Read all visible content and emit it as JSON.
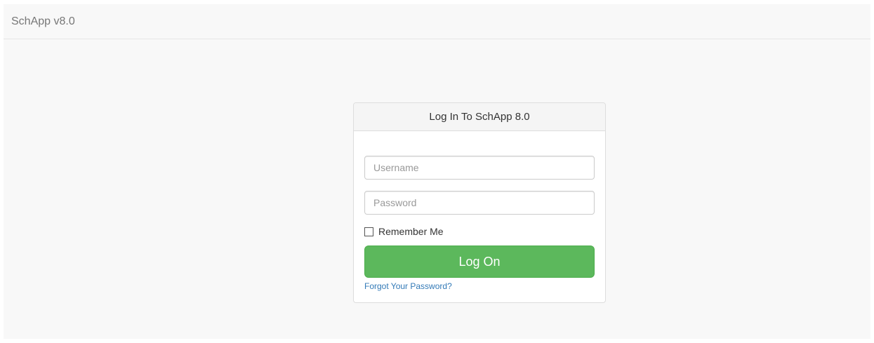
{
  "navbar": {
    "brand": "SchApp v8.0"
  },
  "login": {
    "heading": "Log In To SchApp 8.0",
    "username_placeholder": "Username",
    "password_placeholder": "Password",
    "remember_label": "Remember Me",
    "remember_checked": false,
    "submit_label": "Log On",
    "forgot_label": "Forgot Your Password?"
  },
  "colors": {
    "page_background": "#f8f8f8",
    "button_green": "#5cb85c",
    "link_blue": "#337ab7"
  }
}
